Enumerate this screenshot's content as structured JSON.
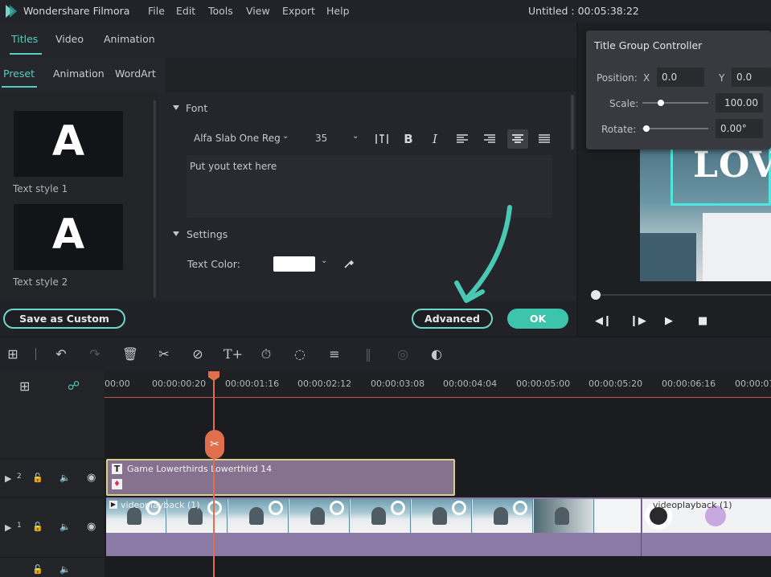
{
  "menubar": {
    "app_title": "Wondershare Filmora",
    "menus": [
      "File",
      "Edit",
      "Tools",
      "View",
      "Export",
      "Help"
    ],
    "document_title": "Untitled : 00:05:38:22"
  },
  "tabs": {
    "top": [
      "Titles",
      "Video",
      "Animation"
    ],
    "sub": [
      "Preset",
      "Animation",
      "WordArt"
    ]
  },
  "presets": [
    {
      "letter": "A",
      "label": "Text style 1"
    },
    {
      "letter": "A",
      "label": "Text style 2"
    }
  ],
  "font_section": {
    "heading": "Font",
    "font_name": "Alfa Slab One Reg",
    "font_size": "35",
    "bold": "B",
    "italic": "I",
    "text_placeholder": "Put yout text here"
  },
  "settings_section": {
    "heading": "Settings",
    "text_color_label": "Text Color:",
    "text_color": "#ffffff"
  },
  "buttons": {
    "save_custom": "Save as Custom",
    "advanced": "Advanced",
    "ok": "OK"
  },
  "title_group_controller": {
    "title": "Title Group Controller",
    "position_label": "Position:",
    "x_label": "X",
    "x_value": "0.0",
    "y_label": "Y",
    "y_value": "0.0",
    "scale_label": "Scale:",
    "scale_value": "100.00",
    "rotate_label": "Rotate:",
    "rotate_value": "0.00°"
  },
  "preview": {
    "overlay_text": "LOV"
  },
  "timeline": {
    "ruler_labels": [
      "00:00",
      "00:00:00:20",
      "00:00:01:16",
      "00:00:02:12",
      "00:00:03:08",
      "00:00:04:04",
      "00:00:05:00",
      "00:00:05:20",
      "00:00:06:16",
      "00:00:07"
    ],
    "tracks": [
      {
        "number": "2"
      },
      {
        "number": "1"
      }
    ],
    "title_clip": "Game Lowerthirds Lowerthird 14",
    "video_clip_1": "videoplayback (1)",
    "video_clip_2": "videoplayback (1)"
  },
  "colors": {
    "accent": "#4fd1bf",
    "playhead": "#e0704d",
    "title_clip": "#86718e",
    "video_clip": "#8a7aa5"
  }
}
